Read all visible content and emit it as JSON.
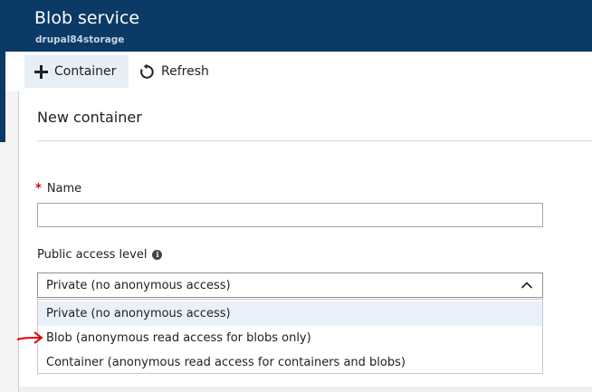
{
  "header": {
    "title": "Blob service",
    "subtitle": "drupal84storage"
  },
  "toolbar": {
    "add_container_label": "Container",
    "refresh_label": "Refresh"
  },
  "panel": {
    "title": "New container",
    "name_field": {
      "required_marker": "*",
      "label": "Name",
      "value": "",
      "placeholder": ""
    },
    "access_level": {
      "label": "Public access level",
      "selected": "Private (no anonymous access)",
      "options": [
        "Private (no anonymous access)",
        "Blob (anonymous read access for blobs only)",
        "Container (anonymous read access for containers and blobs)"
      ]
    }
  },
  "colors": {
    "header_bg": "#0b3a66",
    "highlight_bg": "#e8f1fa",
    "required_star": "#d00000",
    "annotation_arrow": "#e00000"
  },
  "icons": [
    "plus-icon",
    "refresh-icon",
    "info-icon",
    "chevron-up-icon",
    "red-arrow-icon"
  ]
}
